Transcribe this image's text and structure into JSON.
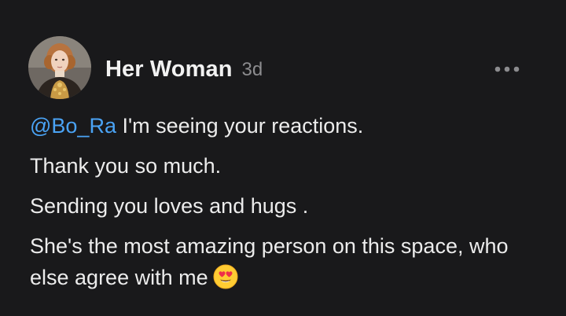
{
  "post": {
    "author_name": "Her Woman",
    "timestamp": "3d",
    "avatar_icon": "profile-portrait",
    "more_icon": "ellipsis-horizontal",
    "mention": "@Bo_Ra",
    "lines": [
      " I'm seeing your reactions.",
      "Thank you so much.",
      "Sending you loves and hugs .",
      "She's the most amazing person on this space, who else agree with me"
    ],
    "emoji": "smiling-face-with-heart-eyes"
  },
  "colors": {
    "background": "#19191b",
    "text": "#ececec",
    "muted": "#8c8c8f",
    "mention": "#4aa3f5"
  }
}
